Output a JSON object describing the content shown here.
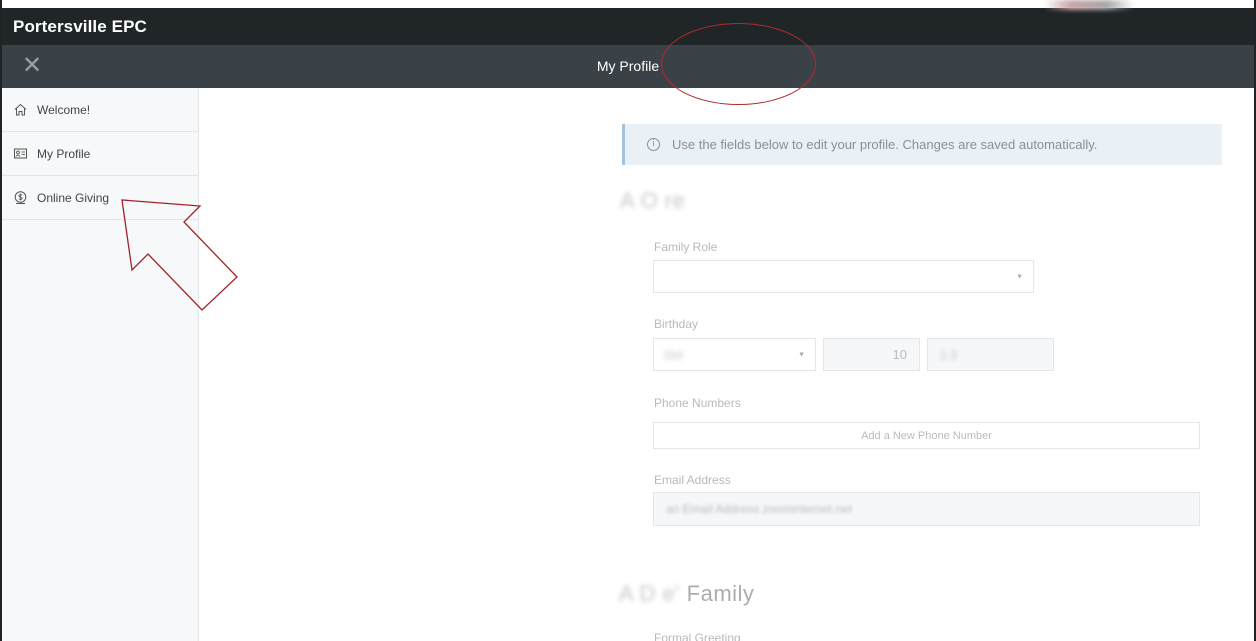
{
  "app": {
    "brand": "Portersville EPC",
    "close_icon": "✕",
    "page_title": "My Profile"
  },
  "sidebar": {
    "items": [
      {
        "label": "Welcome!",
        "icon": "home-icon"
      },
      {
        "label": "My Profile",
        "icon": "id-card-icon"
      },
      {
        "label": "Online Giving",
        "icon": "money-bag-icon"
      }
    ]
  },
  "profile": {
    "info_icon": "i",
    "info_message": "Use the fields below to edit your profile. Changes are saved automatically.",
    "person_name": "A    O      re",
    "family_role_label": "Family Role",
    "family_role_value": "",
    "birthday_label": "Birthday",
    "birthday_month": "Oct   ",
    "birthday_day": "10",
    "birthday_year": "1  3",
    "phone_label": "Phone Numbers",
    "add_phone_button": "Add a New Phone Number",
    "email_label": "Email Address",
    "email_value": "an     Email Address  zoominternet.net",
    "family_heading_name": "A   D        e'",
    "family_heading_suffix": "Family",
    "formal_greeting_label": "Formal Greeting"
  },
  "colors": {
    "annotation": "#b32a2a",
    "top_bar": "#202528",
    "nav_bar": "#3b4247",
    "info_bg": "#e9f1f7"
  }
}
